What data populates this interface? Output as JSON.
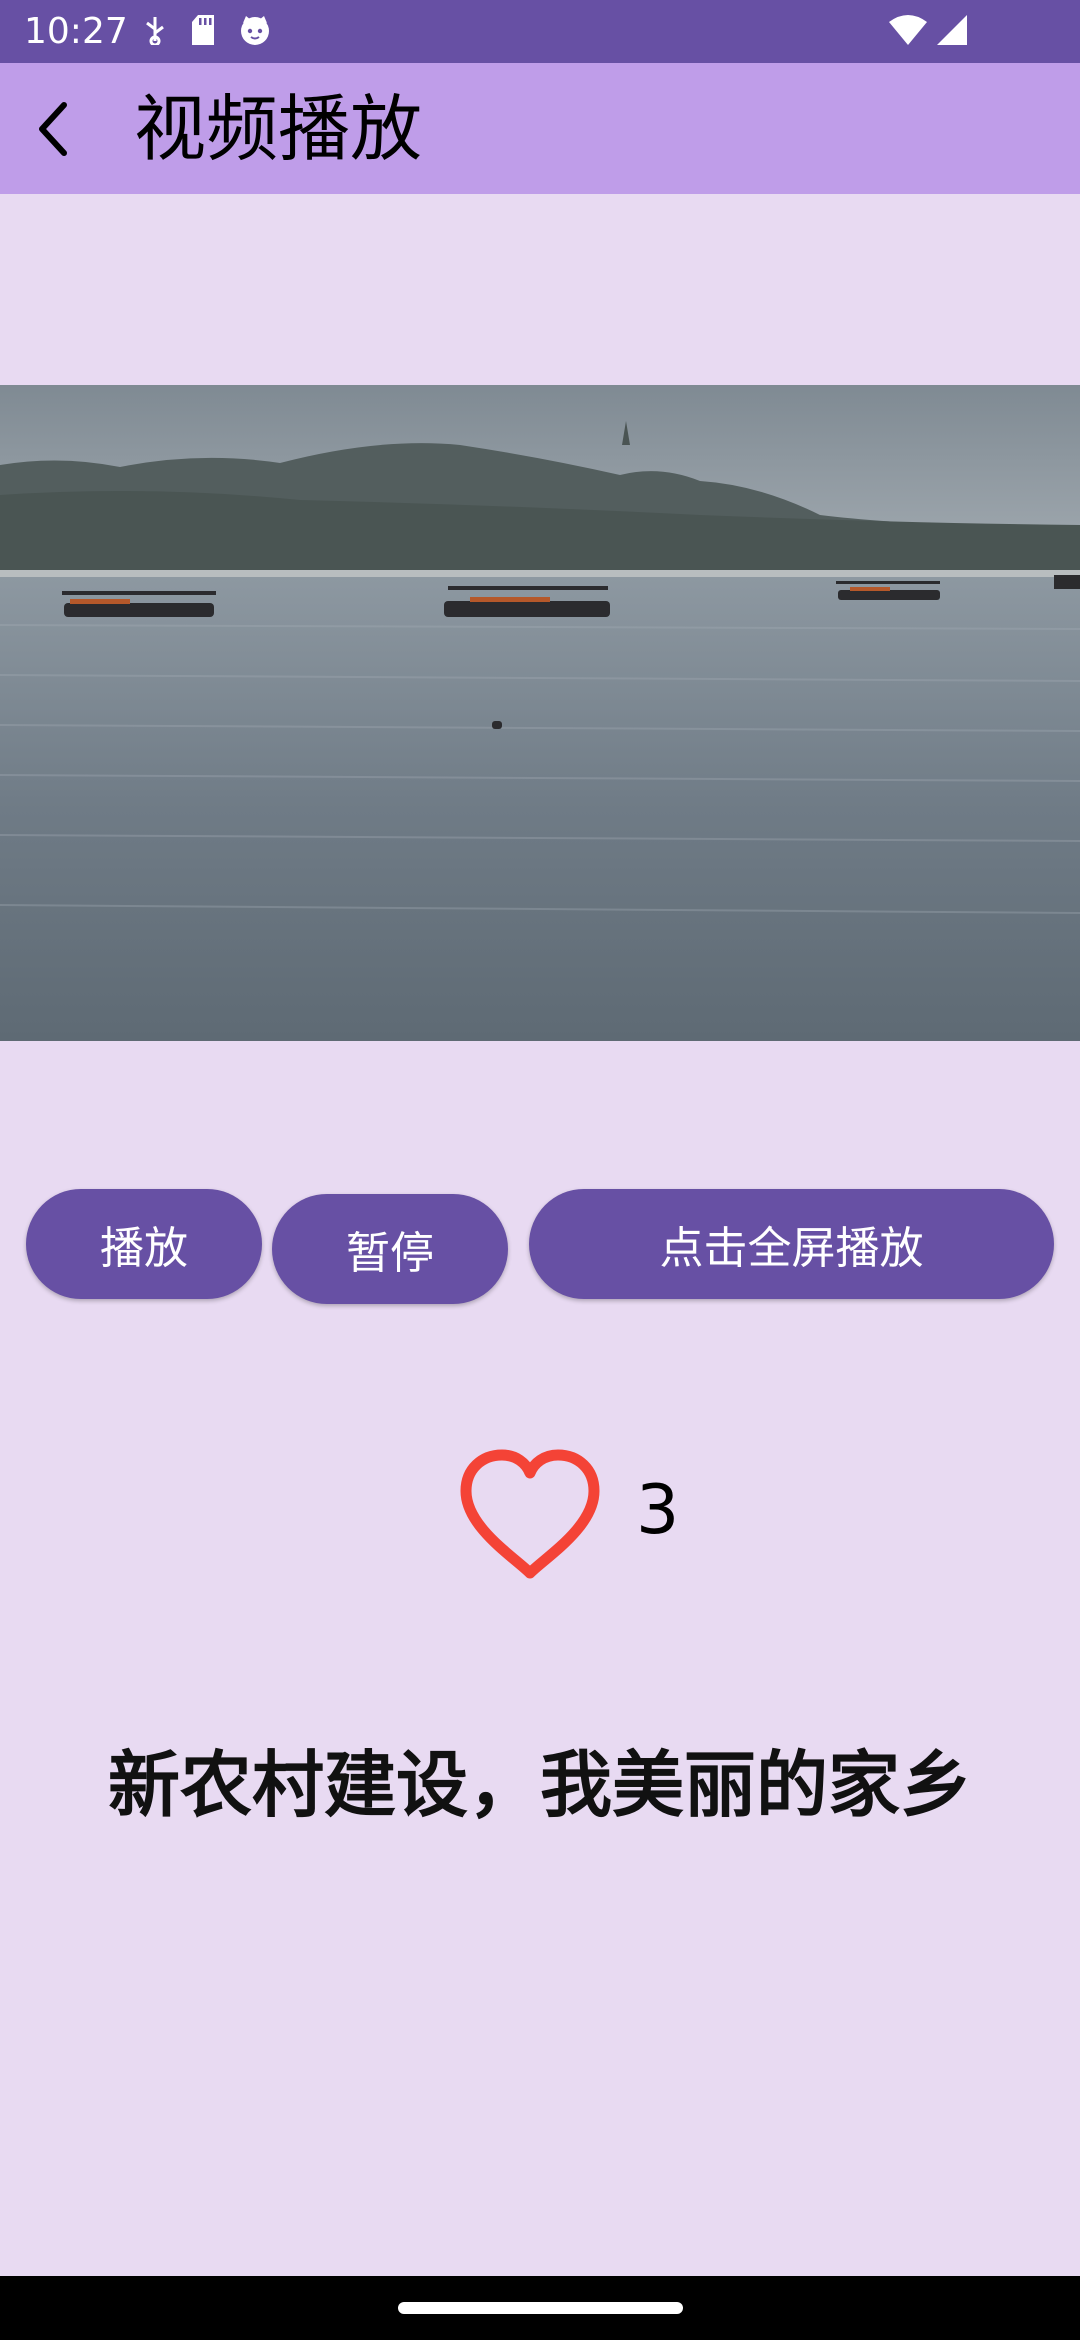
{
  "status_bar": {
    "time": "10:27",
    "left_icons": [
      "usb-debug-icon",
      "sd-card-icon",
      "cat-notification-icon"
    ],
    "right_icons": [
      "wifi-icon",
      "cellular-signal-icon"
    ]
  },
  "app_bar": {
    "back_icon": "arrow-back-icon",
    "title": "视频播放"
  },
  "video": {
    "scene": "lake-with-boats"
  },
  "controls": {
    "play_label": "播放",
    "pause_label": "暂停",
    "fullscreen_label": "点击全屏播放"
  },
  "like": {
    "icon": "heart-outline-icon",
    "count": "3",
    "color": "#f44336"
  },
  "article": {
    "title": "新农村建设，我美丽的家乡"
  },
  "colors": {
    "status_bar": "#6750a4",
    "app_bar": "#bf9de9",
    "background": "#e8daf2",
    "button": "#6750a4"
  }
}
